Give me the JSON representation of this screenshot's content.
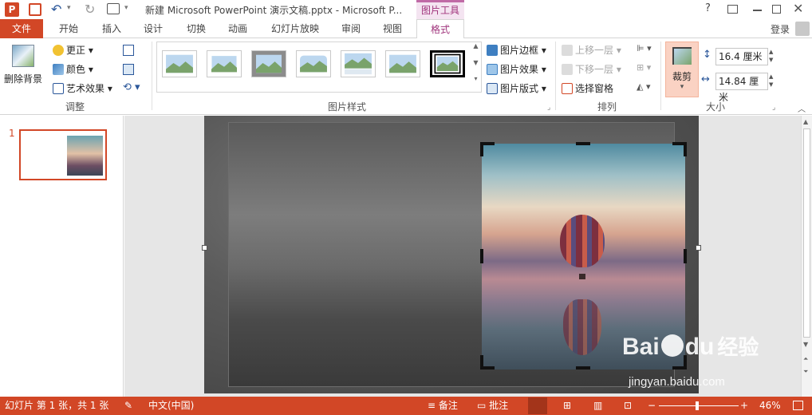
{
  "window": {
    "title": "新建 Microsoft PowerPoint 演示文稿.pptx - Microsoft P...",
    "context_tab": "图片工具",
    "help": "?",
    "login": "登录",
    "accent_color": "#d24726"
  },
  "tabs": [
    "文件",
    "开始",
    "插入",
    "设计",
    "切换",
    "动画",
    "幻灯片放映",
    "审阅",
    "视图",
    "格式"
  ],
  "ribbon": {
    "adjust": {
      "remove_bg": "删除背景",
      "corrections": "更正",
      "color": "颜色",
      "artistic": "艺术效果",
      "group": "调整"
    },
    "styles": {
      "group": "图片样式",
      "border": "图片边框",
      "effects": "图片效果",
      "layout": "图片版式"
    },
    "arrange": {
      "group": "排列",
      "bring_forward": "上移一层",
      "send_backward": "下移一层",
      "selection_pane": "选择窗格"
    },
    "size": {
      "group": "大小",
      "crop": "裁剪",
      "height": "16.4 厘米",
      "width": "14.84 厘米"
    }
  },
  "slides": {
    "number": "1"
  },
  "status": {
    "slide_info": "幻灯片 第 1 张，共 1 张",
    "language": "中文(中国)",
    "notes": "备注",
    "comments": "批注",
    "zoom": "46%"
  },
  "watermark": {
    "brand": "Bai",
    "brand2": "du",
    "cn": "经验",
    "url": "jingyan.baidu.com"
  }
}
